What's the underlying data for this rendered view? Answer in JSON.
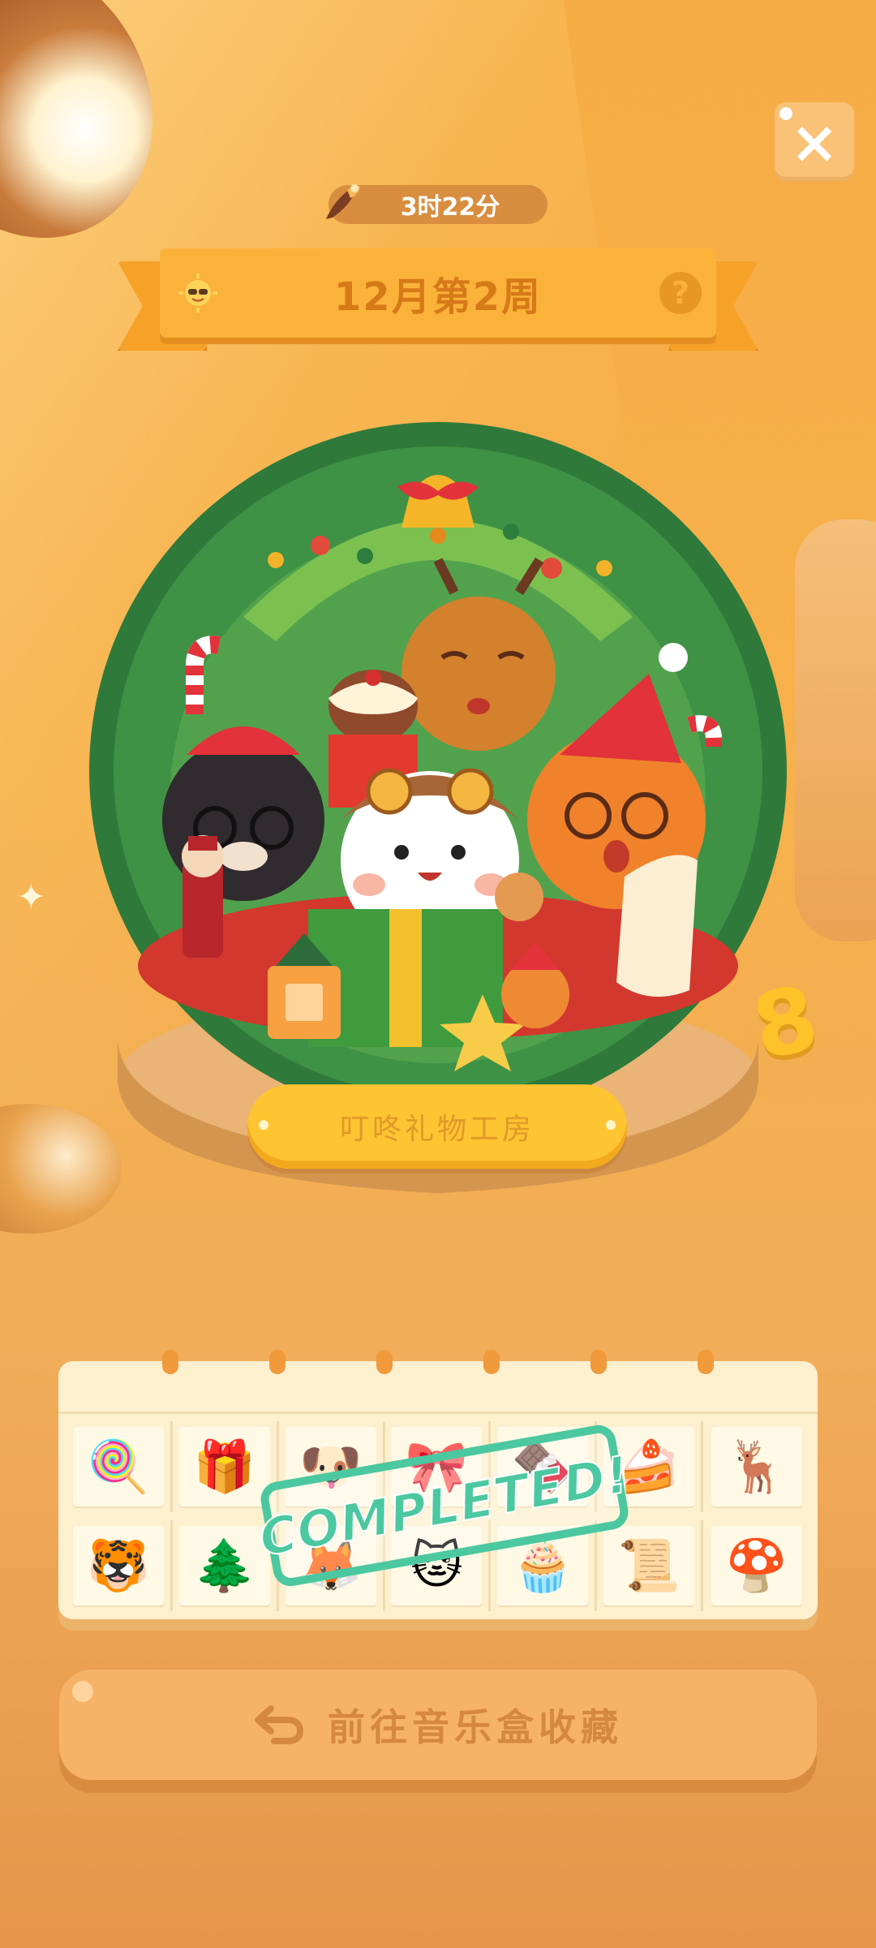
{
  "header": {
    "timer_text": "3时22分",
    "week_title": "12月第2周",
    "close_label": "×",
    "help_label": "?"
  },
  "globe": {
    "plaque_text": "叮咚礼物工房",
    "side_number": "8"
  },
  "sticker_board": {
    "stamp_text": "COMPLETED!",
    "rows": [
      [
        "🍭",
        "🎁",
        "🐶",
        "🎀",
        "🍫",
        "🍰",
        "🦌"
      ],
      [
        "🐯",
        "🌲",
        "🦊",
        "🐱",
        "🧁",
        "📜",
        "🍄"
      ]
    ]
  },
  "footer": {
    "go_button_label": "前往音乐盒收藏"
  },
  "colors": {
    "background": "#f7ad45",
    "ribbon": "#fbb23a",
    "stamp": "#4cc8a0",
    "button": "#f6b367"
  },
  "icons": {
    "timer": "feather-quill-icon",
    "sun": "sun-sunglasses-icon",
    "help": "question-icon",
    "close": "close-icon",
    "go": "return-arrow-icon"
  }
}
